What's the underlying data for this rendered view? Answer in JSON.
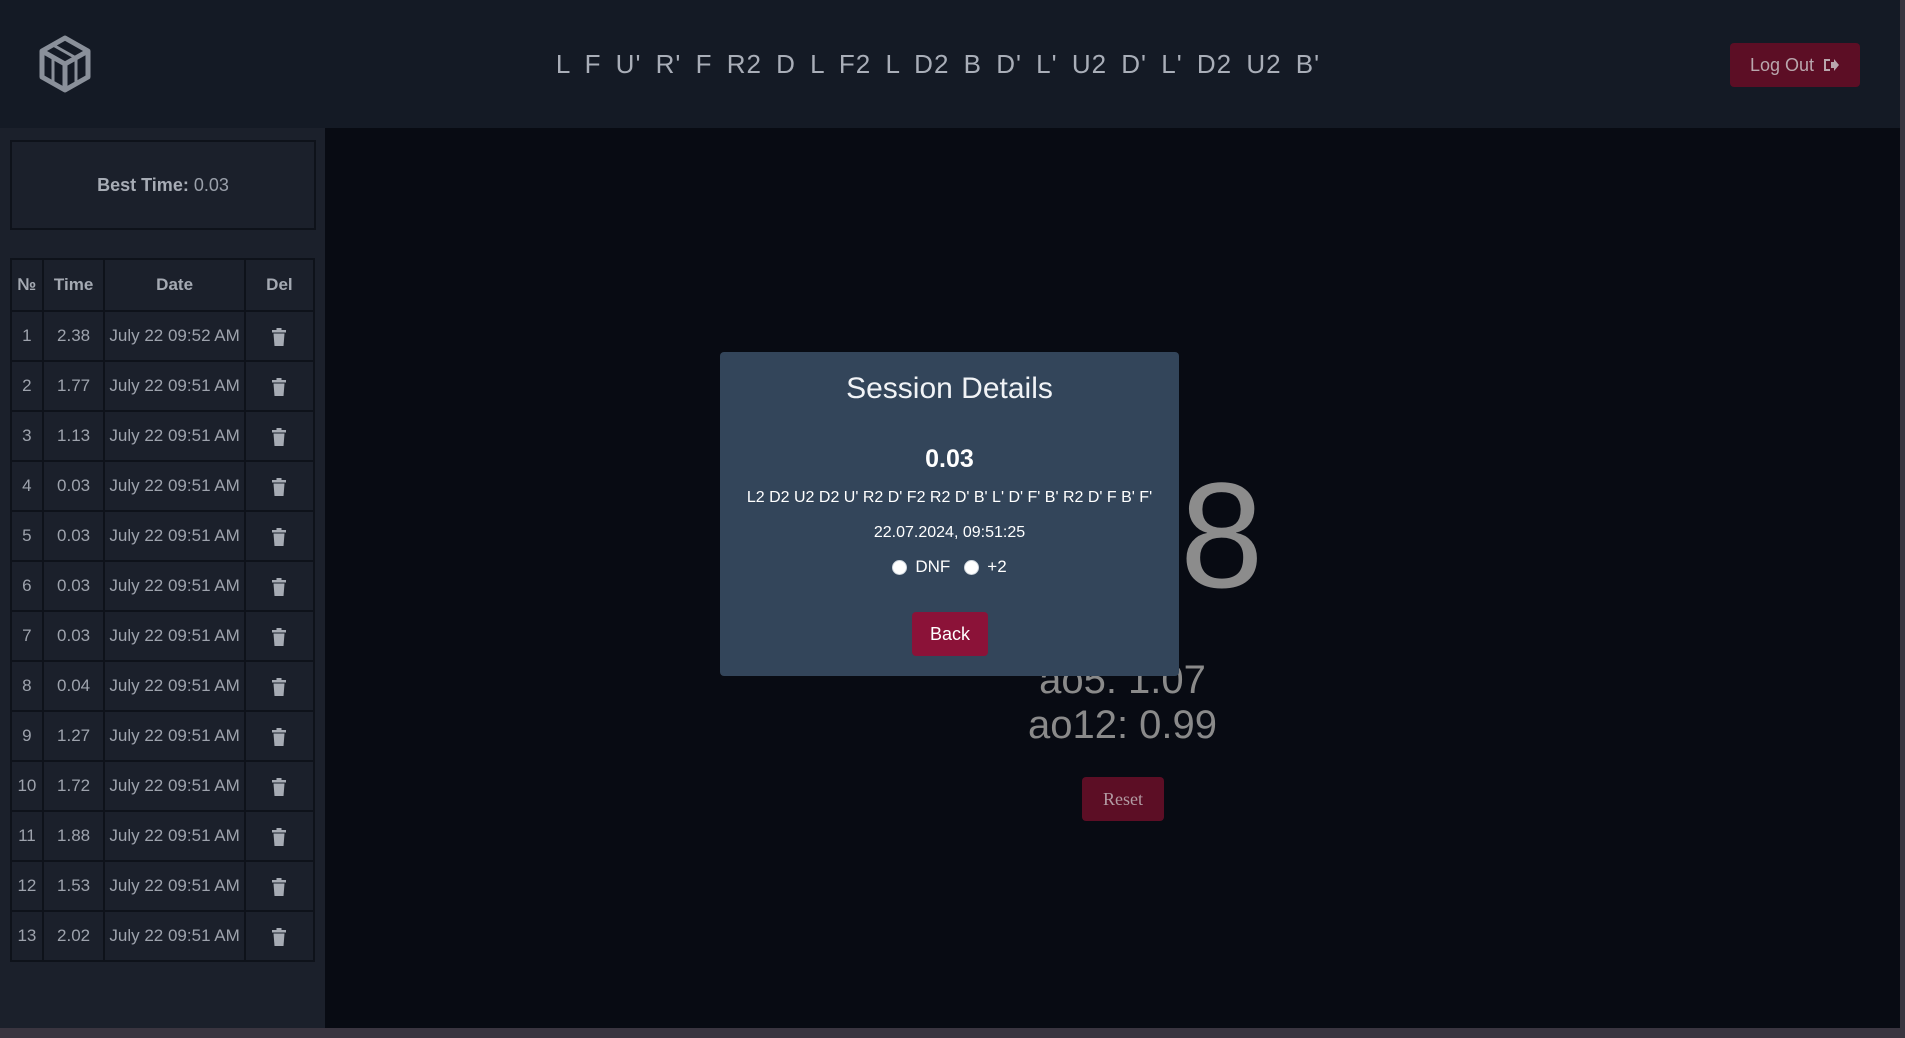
{
  "header": {
    "scramble": "L F U' R' F R2 D L F2 L D2 B D' L' U2 D' L' D2 U2 B'",
    "logout_label": "Log Out",
    "logout_icon": "sign-out-icon",
    "logo_icon": "cube-logo-icon"
  },
  "sidebar": {
    "best_label": "Best Time:",
    "best_value": "0.03",
    "columns": [
      "№",
      "Time",
      "Date",
      "Del"
    ],
    "rows": [
      {
        "n": "1",
        "time": "2.38",
        "date": "July 22 09:52 AM"
      },
      {
        "n": "2",
        "time": "1.77",
        "date": "July 22 09:51 AM"
      },
      {
        "n": "3",
        "time": "1.13",
        "date": "July 22 09:51 AM"
      },
      {
        "n": "4",
        "time": "0.03",
        "date": "July 22 09:51 AM"
      },
      {
        "n": "5",
        "time": "0.03",
        "date": "July 22 09:51 AM"
      },
      {
        "n": "6",
        "time": "0.03",
        "date": "July 22 09:51 AM"
      },
      {
        "n": "7",
        "time": "0.03",
        "date": "July 22 09:51 AM"
      },
      {
        "n": "8",
        "time": "0.04",
        "date": "July 22 09:51 AM"
      },
      {
        "n": "9",
        "time": "1.27",
        "date": "July 22 09:51 AM"
      },
      {
        "n": "10",
        "time": "1.72",
        "date": "July 22 09:51 AM"
      },
      {
        "n": "11",
        "time": "1.88",
        "date": "July 22 09:51 AM"
      },
      {
        "n": "12",
        "time": "1.53",
        "date": "July 22 09:51 AM"
      },
      {
        "n": "13",
        "time": "2.02",
        "date": "July 22 09:51 AM"
      }
    ]
  },
  "main": {
    "timer_visible": "8",
    "ao5": "ao5: 1.07",
    "ao12": "ao12: 0.99",
    "reset_label": "Reset"
  },
  "modal": {
    "title": "Session Details",
    "time": "0.03",
    "scramble": "L2 D2 U2 D2 U' R2 D' F2 R2 D' B' L' D' F' B' R2 D' F B' F'",
    "datetime": "22.07.2024, 09:51:25",
    "dnf_label": "DNF",
    "plus2_label": "+2",
    "back_label": "Back"
  },
  "colors": {
    "accent": "#8b1238",
    "accent_dim": "#5c0e25",
    "modal_bg": "#33455a",
    "sidebar_bg": "#1b202b"
  }
}
